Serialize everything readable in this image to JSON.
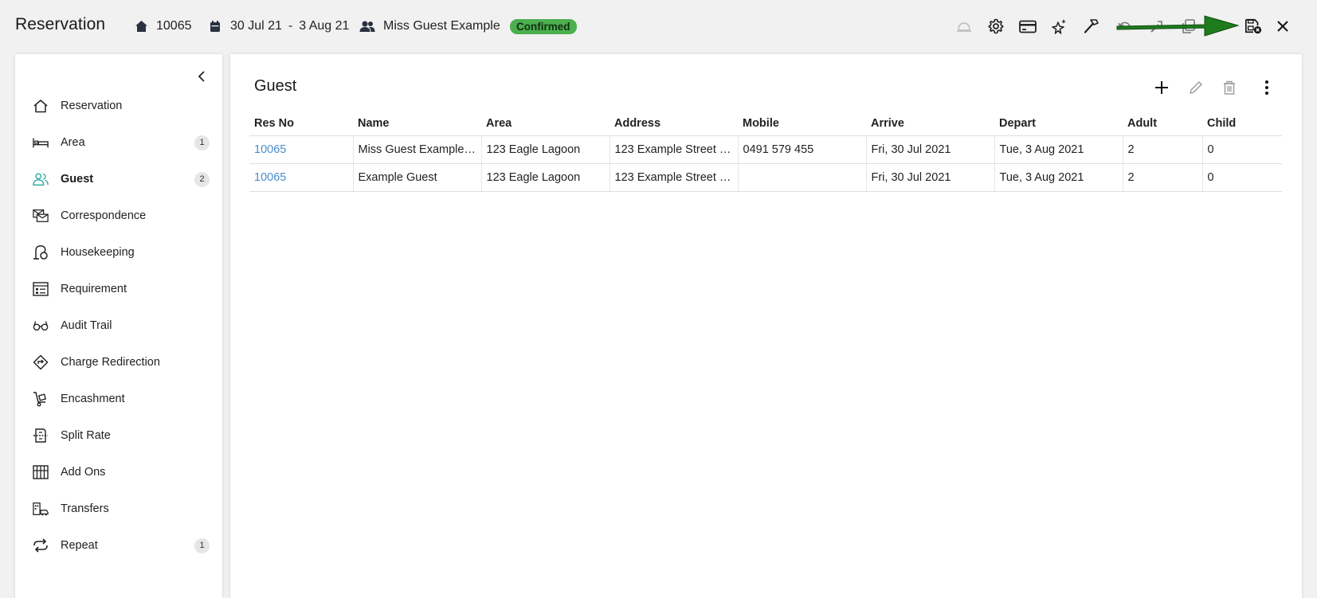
{
  "header": {
    "title": "Reservation",
    "res_no": "10065",
    "date_from": "30 Jul 21",
    "date_sep": "-",
    "date_to": "3 Aug 21",
    "guest_name": "Miss Guest Example",
    "status": "Confirmed",
    "status_color": "#4caf50",
    "toolbar_icons": [
      "bell-icon",
      "gear-icon",
      "credit-card-icon",
      "sparkle-star-icon",
      "hammer-icon",
      "undo-icon",
      "tools-icon",
      "copy-icon",
      "save-close-icon",
      "close-icon"
    ],
    "annotation_arrow_color": "#1e7b1e"
  },
  "sidebar": {
    "items": [
      {
        "label": "Reservation",
        "icon": "home-icon",
        "count": ""
      },
      {
        "label": "Area",
        "icon": "bed-icon",
        "count": "1"
      },
      {
        "label": "Guest",
        "icon": "guest-icon",
        "count": "2",
        "active": true
      },
      {
        "label": "Correspondence",
        "icon": "mail-icon",
        "count": ""
      },
      {
        "label": "Housekeeping",
        "icon": "vacuum-icon",
        "count": ""
      },
      {
        "label": "Requirement",
        "icon": "checklist-icon",
        "count": ""
      },
      {
        "label": "Audit Trail",
        "icon": "glasses-icon",
        "count": ""
      },
      {
        "label": "Charge Redirection",
        "icon": "redirect-icon",
        "count": ""
      },
      {
        "label": "Encashment",
        "icon": "trolley-icon",
        "count": ""
      },
      {
        "label": "Split Rate",
        "icon": "split-icon",
        "count": ""
      },
      {
        "label": "Add Ons",
        "icon": "grid-icon",
        "count": ""
      },
      {
        "label": "Transfers",
        "icon": "transfer-icon",
        "count": ""
      },
      {
        "label": "Repeat",
        "icon": "repeat-icon",
        "count": "1"
      }
    ],
    "accent_color": "#2aa8a0"
  },
  "main": {
    "title": "Guest",
    "columns": [
      "Res No",
      "Name",
      "Area",
      "Address",
      "Mobile",
      "Arrive",
      "Depart",
      "Adult",
      "Child"
    ],
    "rows": [
      [
        "10065",
        "Miss Guest Example (...",
        "123 Eagle Lagoon",
        "123 Example Street E...",
        "0491 579 455",
        "Fri, 30 Jul 2021",
        "Tue, 3 Aug 2021",
        "2",
        "0"
      ],
      [
        "10065",
        "Example Guest",
        "123 Eagle Lagoon",
        "123 Example Street 3...",
        "",
        "Fri, 30 Jul 2021",
        "Tue, 3 Aug 2021",
        "2",
        "0"
      ]
    ],
    "link_color": "#4a8ec9"
  }
}
